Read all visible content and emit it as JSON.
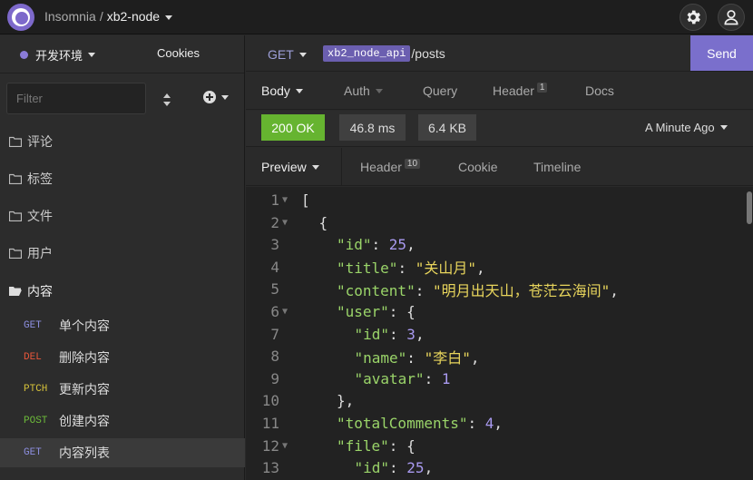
{
  "app": {
    "name": "Insomnia",
    "separator": "/",
    "workspace": "xb2-node"
  },
  "sidebar": {
    "environment": "开发环境",
    "cookies_label": "Cookies",
    "filter_placeholder": "Filter",
    "folders": [
      {
        "label": "评论",
        "open": false
      },
      {
        "label": "标签",
        "open": false
      },
      {
        "label": "文件",
        "open": false
      },
      {
        "label": "用户",
        "open": false
      },
      {
        "label": "内容",
        "open": true
      }
    ],
    "requests": [
      {
        "method": "GET",
        "label": "单个内容",
        "color": "#8d8fe0"
      },
      {
        "method": "DEL",
        "label": "删除内容",
        "color": "#e8563a"
      },
      {
        "method": "PTCH",
        "label": "更新内容",
        "color": "#d6c23a"
      },
      {
        "method": "POST",
        "label": "创建内容",
        "color": "#6dbb3a"
      },
      {
        "method": "GET",
        "label": "内容列表",
        "color": "#8d8fe0",
        "active": true
      }
    ]
  },
  "request": {
    "method": "GET",
    "url_variable": "xb2_node_api",
    "url_path": "/posts",
    "send_label": "Send",
    "tabs": [
      {
        "label": "Body",
        "badge": ""
      },
      {
        "label": "Auth",
        "badge": ""
      },
      {
        "label": "Query",
        "badge": ""
      },
      {
        "label": "Header",
        "badge": "1"
      },
      {
        "label": "Docs",
        "badge": ""
      }
    ]
  },
  "response": {
    "status": "200 OK",
    "time": "46.8 ms",
    "size": "6.4 KB",
    "when": "A Minute Ago",
    "tabs": [
      {
        "label": "Preview",
        "badge": ""
      },
      {
        "label": "Header",
        "badge": "10"
      },
      {
        "label": "Cookie",
        "badge": ""
      },
      {
        "label": "Timeline",
        "badge": ""
      }
    ],
    "lines": [
      {
        "n": "1",
        "fold": true,
        "indent": 0,
        "parts": [
          [
            "p",
            "["
          ]
        ]
      },
      {
        "n": "2",
        "fold": true,
        "indent": 1,
        "parts": [
          [
            "p",
            "{"
          ]
        ]
      },
      {
        "n": "3",
        "fold": false,
        "indent": 2,
        "parts": [
          [
            "k",
            "\"id\""
          ],
          [
            "p",
            ": "
          ],
          [
            "n",
            "25"
          ],
          [
            "p",
            ","
          ]
        ]
      },
      {
        "n": "4",
        "fold": false,
        "indent": 2,
        "parts": [
          [
            "k",
            "\"title\""
          ],
          [
            "p",
            ": "
          ],
          [
            "s",
            "\"关山月\""
          ],
          [
            "p",
            ","
          ]
        ]
      },
      {
        "n": "5",
        "fold": false,
        "indent": 2,
        "parts": [
          [
            "k",
            "\"content\""
          ],
          [
            "p",
            ": "
          ],
          [
            "s",
            "\"明月出天山，苍茫云海间\""
          ],
          [
            "p",
            ","
          ]
        ]
      },
      {
        "n": "6",
        "fold": true,
        "indent": 2,
        "parts": [
          [
            "k",
            "\"user\""
          ],
          [
            "p",
            ": {"
          ]
        ]
      },
      {
        "n": "7",
        "fold": false,
        "indent": 3,
        "parts": [
          [
            "k",
            "\"id\""
          ],
          [
            "p",
            ": "
          ],
          [
            "n",
            "3"
          ],
          [
            "p",
            ","
          ]
        ]
      },
      {
        "n": "8",
        "fold": false,
        "indent": 3,
        "parts": [
          [
            "k",
            "\"name\""
          ],
          [
            "p",
            ": "
          ],
          [
            "s",
            "\"李白\""
          ],
          [
            "p",
            ","
          ]
        ]
      },
      {
        "n": "9",
        "fold": false,
        "indent": 3,
        "parts": [
          [
            "k",
            "\"avatar\""
          ],
          [
            "p",
            ": "
          ],
          [
            "n",
            "1"
          ]
        ]
      },
      {
        "n": "10",
        "fold": false,
        "indent": 2,
        "parts": [
          [
            "p",
            "},"
          ]
        ]
      },
      {
        "n": "11",
        "fold": false,
        "indent": 2,
        "parts": [
          [
            "k",
            "\"totalComments\""
          ],
          [
            "p",
            ": "
          ],
          [
            "n",
            "4"
          ],
          [
            "p",
            ","
          ]
        ]
      },
      {
        "n": "12",
        "fold": true,
        "indent": 2,
        "parts": [
          [
            "k",
            "\"file\""
          ],
          [
            "p",
            ": {"
          ]
        ]
      },
      {
        "n": "13",
        "fold": false,
        "indent": 3,
        "parts": [
          [
            "k",
            "\"id\""
          ],
          [
            "p",
            ": "
          ],
          [
            "n",
            "25"
          ],
          [
            "p",
            ","
          ]
        ]
      }
    ]
  }
}
